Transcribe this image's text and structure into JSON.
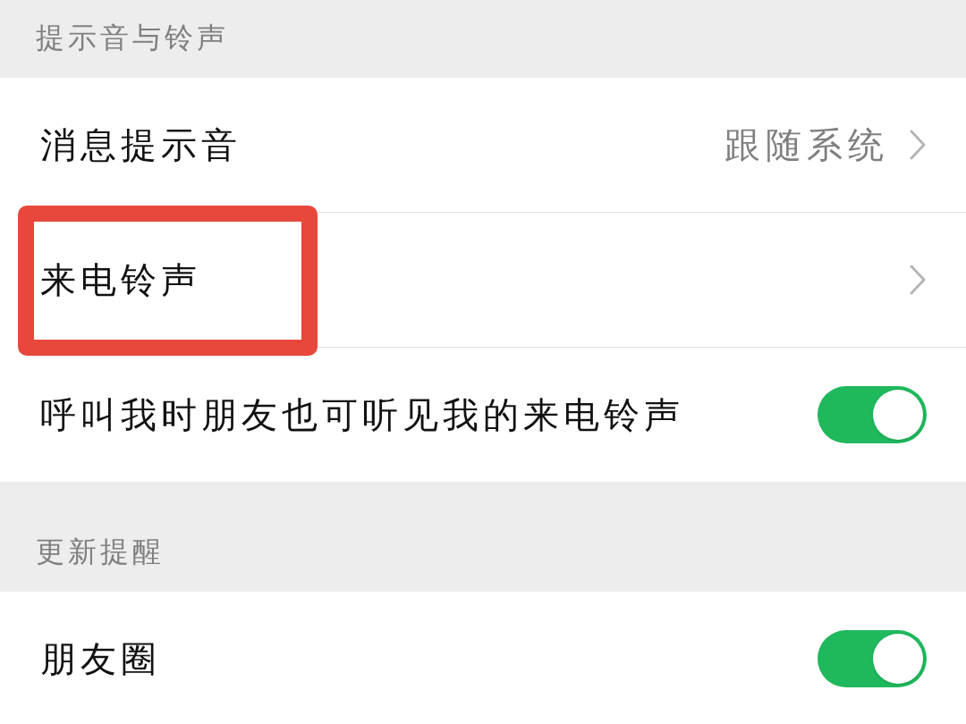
{
  "sections": [
    {
      "title": "提示音与铃声",
      "rows": [
        {
          "kind": "link",
          "label": "消息提示音",
          "value": "跟随系统",
          "highlighted": false
        },
        {
          "kind": "link",
          "label": "来电铃声",
          "highlighted": true
        },
        {
          "kind": "toggle",
          "label": "呼叫我时朋友也可听见我的来电铃声",
          "on": true,
          "highlighted": false
        }
      ]
    },
    {
      "title": "更新提醒",
      "rows": [
        {
          "kind": "toggle",
          "label": "朋友圈",
          "on": true,
          "highlighted": false
        }
      ]
    }
  ]
}
